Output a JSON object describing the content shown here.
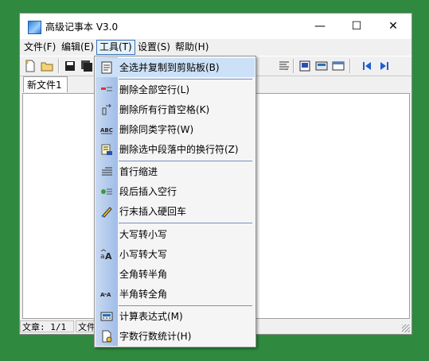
{
  "window": {
    "title": "高级记事本 V3.0",
    "minimize": "—",
    "maximize": "☐",
    "close": "✕"
  },
  "menubar": [
    {
      "label": "文件(F)"
    },
    {
      "label": "编辑(E)"
    },
    {
      "label": "工具(T)"
    },
    {
      "label": "设置(S)"
    },
    {
      "label": "帮助(H)"
    }
  ],
  "tabs": [
    {
      "label": "新文件1"
    }
  ],
  "status": {
    "article": "文章: 1/1",
    "file": "文件"
  },
  "tools_menu": {
    "items": [
      {
        "label": "全选并复制到剪贴板(B)",
        "icon": "copy-to-clipboard-icon"
      },
      {
        "label": "删除全部空行(L)",
        "icon": "delete-empty-lines-icon"
      },
      {
        "label": "删除所有行首空格(K)",
        "icon": "delete-leading-spaces-icon"
      },
      {
        "label": "删除同类字符(W)",
        "icon": "abc-icon"
      },
      {
        "label": "删除选中段落中的换行符(Z)",
        "icon": "delete-line-breaks-icon"
      },
      {
        "label": "首行缩进",
        "icon": "indent-icon"
      },
      {
        "label": "段后插入空行",
        "icon": "insert-blank-line-icon"
      },
      {
        "label": "行末插入硬回车",
        "icon": "pen-icon"
      },
      {
        "label": "大写转小写",
        "icon": ""
      },
      {
        "label": "小写转大写",
        "icon": "case-convert-icon"
      },
      {
        "label": "全角转半角",
        "icon": ""
      },
      {
        "label": "半角转全角",
        "icon": "width-convert-icon"
      },
      {
        "label": "计算表达式(M)",
        "icon": "calculator-icon"
      },
      {
        "label": "字数行数统计(H)",
        "icon": "statistics-icon"
      }
    ]
  },
  "colors": {
    "desktop": "#2f8a3f",
    "menu_gutter": "#9fbde8",
    "menu_highlight": "#cce1f7"
  }
}
